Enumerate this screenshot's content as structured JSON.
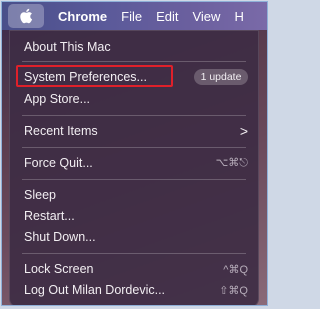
{
  "menubar": {
    "apple_icon": "apple-logo",
    "items": [
      "Chrome",
      "File",
      "Edit",
      "View",
      "H"
    ]
  },
  "apple_menu": {
    "about": "About This Mac",
    "system_prefs": "System Preferences...",
    "update_badge": "1 update",
    "app_store": "App Store...",
    "recent_items": "Recent Items",
    "recent_chevron": ">",
    "force_quit": "Force Quit...",
    "force_quit_shortcut": "⌥⌘⎋",
    "sleep": "Sleep",
    "restart": "Restart...",
    "shut_down": "Shut Down...",
    "lock_screen": "Lock Screen",
    "lock_shortcut": "^⌘Q",
    "log_out": "Log Out Milan Dordevic...",
    "log_out_shortcut": "⇧⌘Q"
  },
  "highlight_color": "#e0202a"
}
